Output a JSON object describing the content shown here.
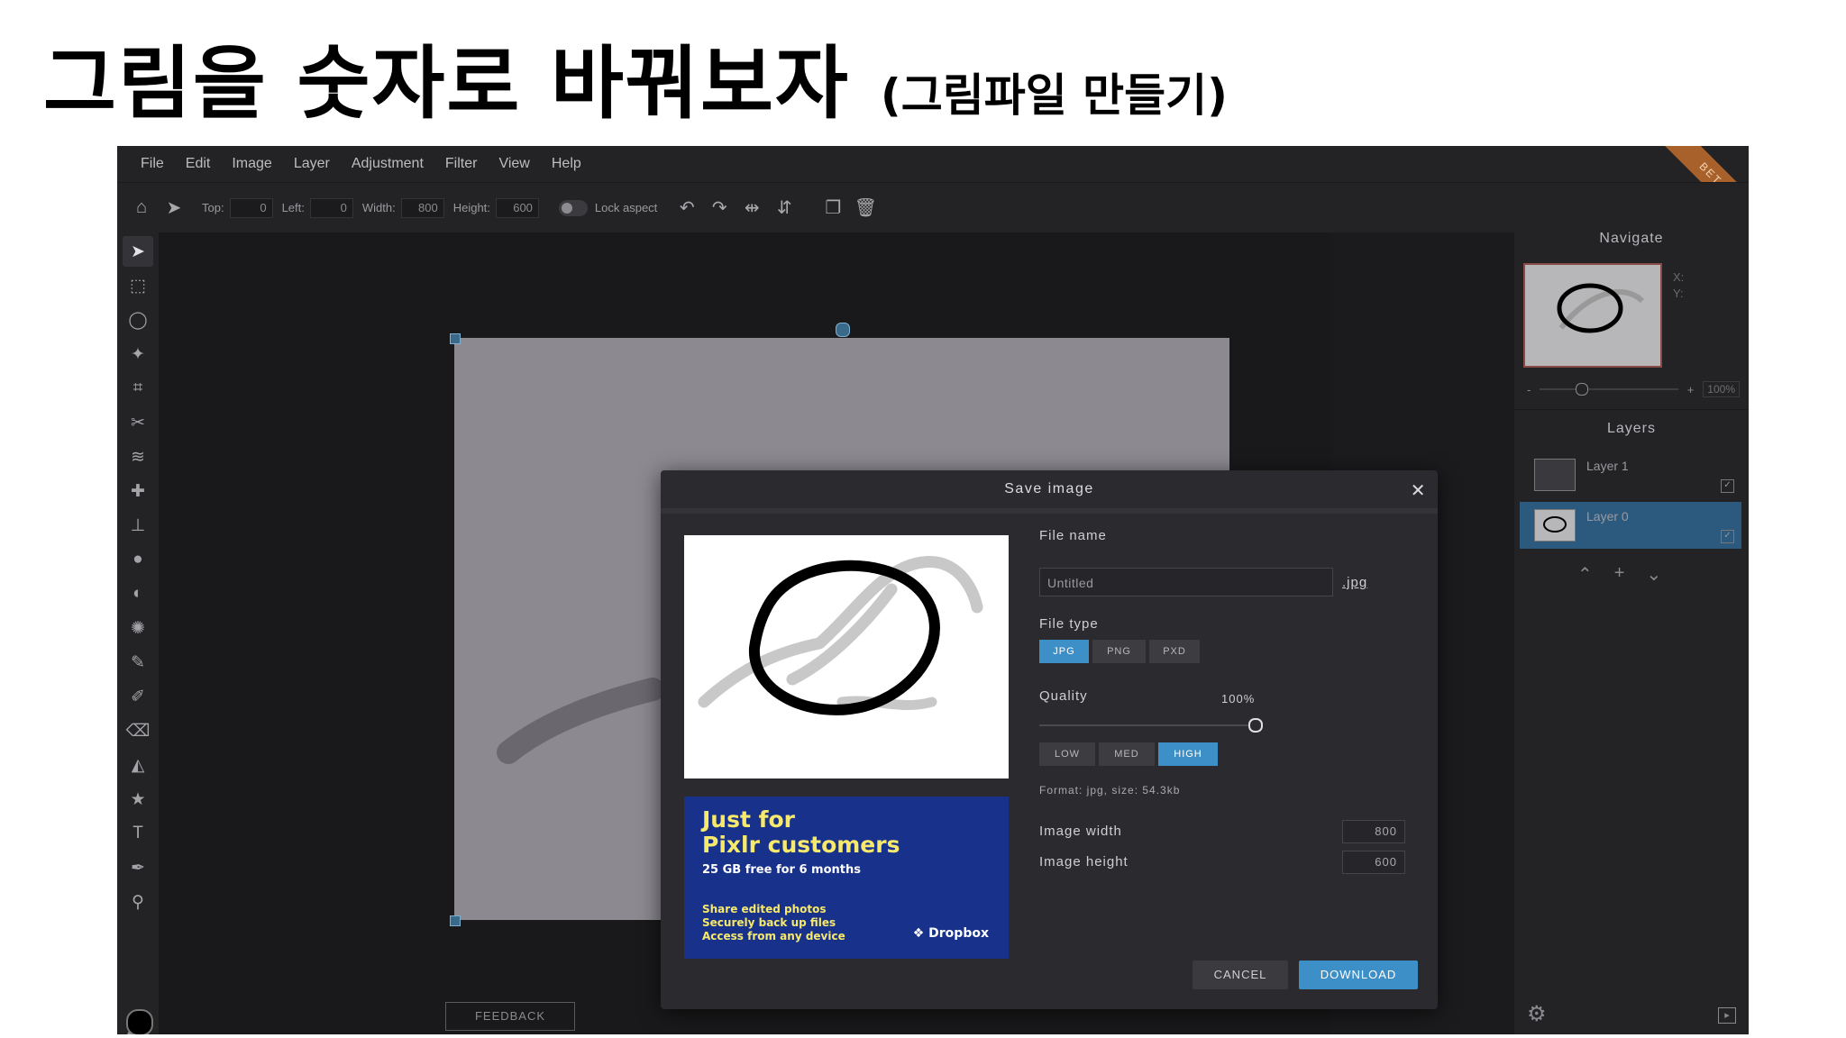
{
  "slide": {
    "title": "그림을 숫자로 바꿔보자",
    "subtitle": "(그림파일 만들기)"
  },
  "menu": [
    "File",
    "Edit",
    "Image",
    "Layer",
    "Adjustment",
    "Filter",
    "View",
    "Help"
  ],
  "toolbar": {
    "top_label": "Top:",
    "top_value": "0",
    "left_label": "Left:",
    "left_value": "0",
    "width_label": "Width:",
    "width_value": "800",
    "height_label": "Height:",
    "height_value": "600",
    "lock_label": "Lock aspect"
  },
  "beta": "BETA",
  "left_tools": [
    "move-arrow",
    "marquee",
    "lasso",
    "magic-wand",
    "crop",
    "cut",
    "liquify",
    "heal",
    "stamp",
    "blur-drop",
    "dodge",
    "sponge",
    "pencil",
    "brush",
    "eraser",
    "fill-bucket",
    "shape-star",
    "type",
    "color-picker",
    "zoom"
  ],
  "feedback": "FEEDBACK",
  "navigate": {
    "title": "Navigate",
    "x_label": "X:",
    "y_label": "Y:",
    "zoom_minus": "-",
    "zoom_plus": "+",
    "zoom_value": "100%"
  },
  "layers": {
    "title": "Layers",
    "items": [
      {
        "name": "Layer 1",
        "active": false
      },
      {
        "name": "Layer 0",
        "active": true
      }
    ]
  },
  "dialog": {
    "title": "Save image",
    "close": "✕",
    "file_name_label": "File name",
    "file_name_value": "Untitled",
    "extension": ".jpg",
    "file_type_label": "File type",
    "file_types": [
      "JPG",
      "PNG",
      "PXD"
    ],
    "file_type_selected": "JPG",
    "quality_label": "Quality",
    "quality_value": "100%",
    "quality_fraction": 1.0,
    "quality_presets": [
      "LOW",
      "MED",
      "HIGH"
    ],
    "quality_preset_selected": "HIGH",
    "format_info": "Format: jpg, size: 54.3kb",
    "image_width_label": "Image width",
    "image_width_value": "800",
    "image_height_label": "Image height",
    "image_height_value": "600",
    "cancel": "CANCEL",
    "download": "DOWNLOAD"
  },
  "ad": {
    "headline_1": "Just for",
    "headline_2": "Pixlr customers",
    "offer": "25 GB free for 6 months",
    "line_1": "Share edited photos",
    "line_2": "Securely back up files",
    "line_3": "Access from any device",
    "brand": "Dropbox"
  },
  "colors": {
    "accent": "#3d8fc7",
    "ad_background": "#18328c",
    "ad_text": "#f7e96b",
    "beta_ribbon": "#a8612a"
  }
}
